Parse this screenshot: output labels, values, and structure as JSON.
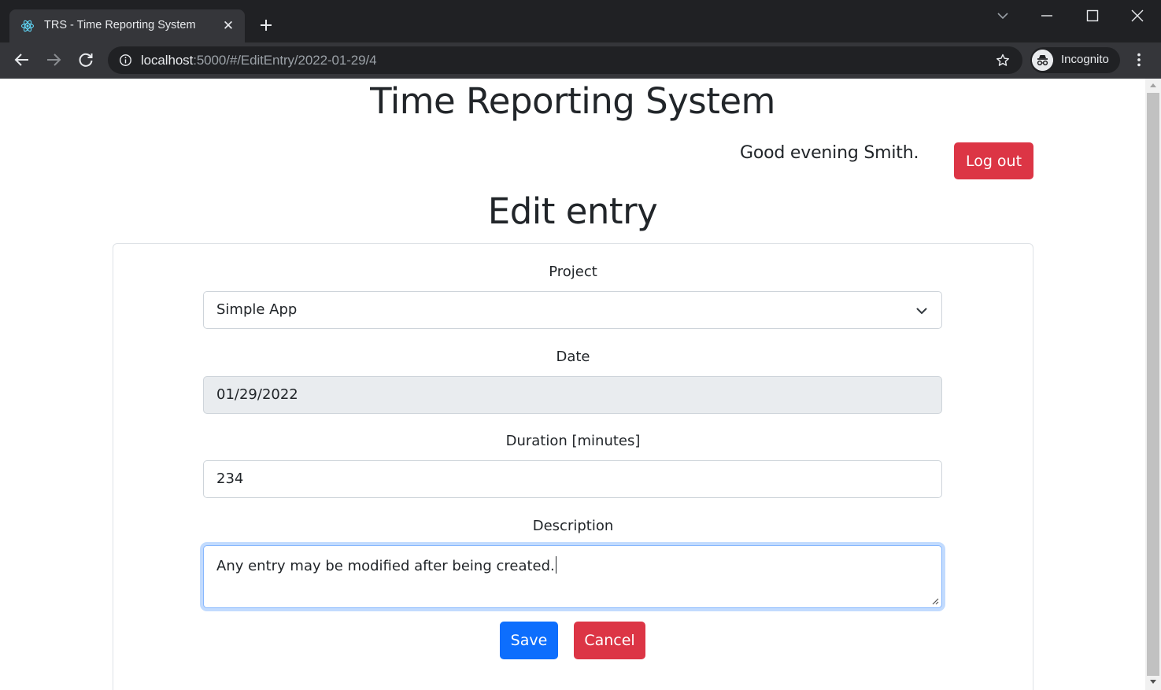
{
  "browser": {
    "tab_title": "TRS - Time Reporting System",
    "url_host": "localhost",
    "url_rest": ":5000/#/EditEntry/2022-01-29/4",
    "profile_label": "Incognito"
  },
  "header": {
    "app_title": "Time Reporting System",
    "greeting": "Good evening Smith.",
    "logout_label": "Log out"
  },
  "page": {
    "heading": "Edit entry"
  },
  "form": {
    "project": {
      "label": "Project",
      "value": "Simple App"
    },
    "date": {
      "label": "Date",
      "value": "01/29/2022"
    },
    "duration": {
      "label": "Duration [minutes]",
      "value": "234"
    },
    "description": {
      "label": "Description",
      "value": "Any entry may be modified after being created."
    },
    "save_label": "Save",
    "cancel_label": "Cancel"
  },
  "colors": {
    "primary": "#0d6efd",
    "danger": "#dc3545",
    "chrome_dark": "#202124",
    "chrome_toolbar": "#35363a"
  }
}
